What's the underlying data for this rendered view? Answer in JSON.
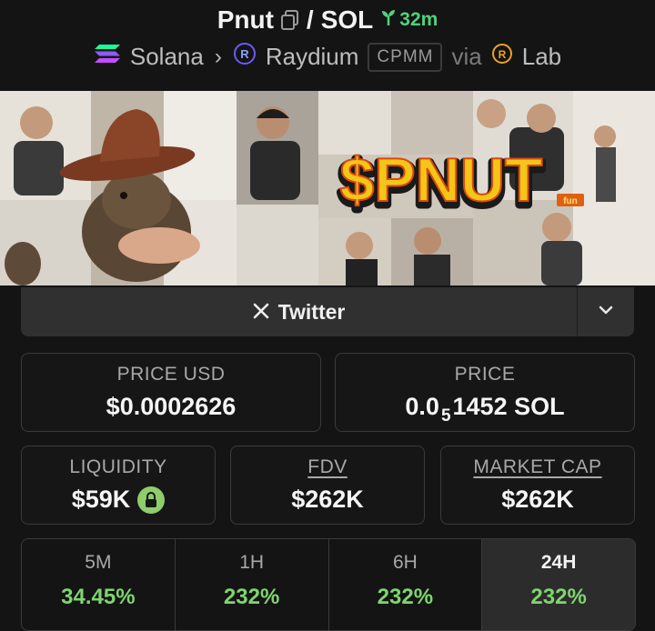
{
  "header": {
    "token_symbol": "Pnut",
    "separator": "/",
    "quote_symbol": "SOL",
    "age": "32m",
    "chain": "Solana",
    "dex": "Raydium",
    "pool_type": "CPMM",
    "via_text": "via",
    "launchpad": "Lab"
  },
  "banner": {
    "text": "$PNUT",
    "tag": "fun"
  },
  "links": {
    "twitter_label": "Twitter"
  },
  "stats": {
    "price_usd_label": "PRICE USD",
    "price_usd_value": "$0.0002626",
    "price_label": "PRICE",
    "price_prefix": "0.0",
    "price_subscript": "5",
    "price_suffix": "1452 SOL",
    "liquidity_label": "LIQUIDITY",
    "liquidity_value": "$59K",
    "fdv_label": "FDV",
    "fdv_value": "$262K",
    "mcap_label": "MARKET CAP",
    "mcap_value": "$262K"
  },
  "changes": [
    {
      "label": "5M",
      "value": "34.45%"
    },
    {
      "label": "1H",
      "value": "232%"
    },
    {
      "label": "6H",
      "value": "232%"
    },
    {
      "label": "24H",
      "value": "232%"
    }
  ],
  "colors": {
    "background": "#141414",
    "positive": "#7ed56f",
    "age_green": "#4fd27b",
    "banner_text": "#f5c518"
  }
}
